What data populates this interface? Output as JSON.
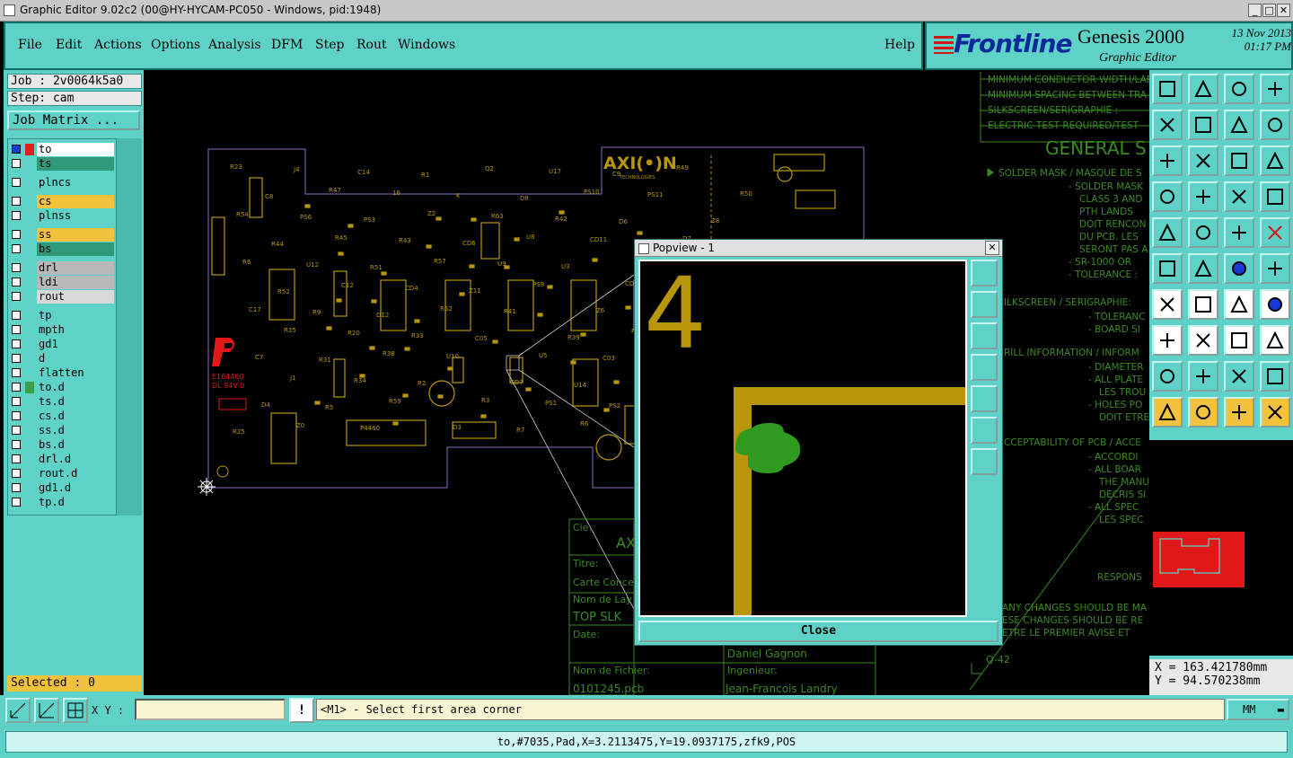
{
  "window": {
    "title": "Graphic Editor 9.02c2 (00@HY-HYCAM-PC050 - Windows, pid:1948)",
    "minimize": "_",
    "maximize": "□",
    "close": "✕"
  },
  "menu": {
    "file": "File",
    "edit": "Edit",
    "actions": "Actions",
    "options": "Options",
    "analysis": "Analysis",
    "dfm": "DFM",
    "step": "Step",
    "rout": "Rout",
    "windows": "Windows",
    "help": "Help"
  },
  "brand": {
    "logo": "Frontline",
    "product": "Genesis 2000",
    "subtitle": "Graphic Editor",
    "date": "13 Nov 2013",
    "time": "01:17 PM"
  },
  "left": {
    "job": "Job : 2v0064k5a0",
    "step": "Step: cam",
    "job_matrix": "Job Matrix ...",
    "selected": "Selected : 0",
    "layers": [
      {
        "name": "to",
        "checked": true,
        "swatch": "#e02020",
        "bg": "#ffffff"
      },
      {
        "name": "ts",
        "checked": false,
        "swatch": "",
        "bg": "#2e9a78"
      },
      {
        "name": "plncs",
        "checked": false,
        "swatch": "",
        "bg": "#5fd2c8"
      },
      {
        "name": "cs",
        "checked": false,
        "swatch": "",
        "bg": "#f2c23c"
      },
      {
        "name": "plnss",
        "checked": false,
        "swatch": "",
        "bg": "#5fd2c8"
      },
      {
        "name": "ss",
        "checked": false,
        "swatch": "",
        "bg": "#f2c23c"
      },
      {
        "name": "bs",
        "checked": false,
        "swatch": "",
        "bg": "#2e9a78"
      },
      {
        "name": "drl",
        "checked": false,
        "swatch": "",
        "bg": "#b8b8b8"
      },
      {
        "name": "ldi",
        "checked": false,
        "swatch": "",
        "bg": "#b8b8b8"
      },
      {
        "name": "rout",
        "checked": false,
        "swatch": "",
        "bg": "#d8d8d8"
      },
      {
        "name": "tp",
        "checked": false,
        "swatch": "",
        "bg": "#5fd2c8"
      },
      {
        "name": "mpth",
        "checked": false,
        "swatch": "",
        "bg": "#5fd2c8"
      },
      {
        "name": "gd1",
        "checked": false,
        "swatch": "",
        "bg": "#5fd2c8"
      },
      {
        "name": "d",
        "checked": false,
        "swatch": "",
        "bg": "#5fd2c8"
      },
      {
        "name": "flatten",
        "checked": false,
        "swatch": "",
        "bg": "#5fd2c8"
      },
      {
        "name": "to.d",
        "checked": false,
        "swatch": "#3aa04a",
        "bg": "#5fd2c8"
      },
      {
        "name": "ts.d",
        "checked": false,
        "swatch": "",
        "bg": "#5fd2c8"
      },
      {
        "name": "cs.d",
        "checked": false,
        "swatch": "",
        "bg": "#5fd2c8"
      },
      {
        "name": "ss.d",
        "checked": false,
        "swatch": "",
        "bg": "#5fd2c8"
      },
      {
        "name": "bs.d",
        "checked": false,
        "swatch": "",
        "bg": "#5fd2c8"
      },
      {
        "name": "drl.d",
        "checked": false,
        "swatch": "",
        "bg": "#5fd2c8"
      },
      {
        "name": "rout.d",
        "checked": false,
        "swatch": "",
        "bg": "#5fd2c8"
      },
      {
        "name": "gd1.d",
        "checked": false,
        "swatch": "",
        "bg": "#5fd2c8"
      },
      {
        "name": "tp.d",
        "checked": false,
        "swatch": "",
        "bg": "#5fd2c8"
      }
    ]
  },
  "canvas": {
    "board_logo": "AXI(•)N",
    "board_logo_sub": "TECHNOLOGIES",
    "ul_marking_1": "E164460",
    "ul_marking_2": "DL 94V-0",
    "notes": [
      "MINIMUM CONDUCTOR WIDTH/LAR",
      "MINIMUM SPACING BETWEEN TRA",
      "SILKSCREEN/SERIGRAPHIE :",
      "ELECTRIC TEST REQUIRED/TEST"
    ],
    "general_notes_title": "GENERAL S",
    "solder_mask_title": "SOLDER MASK / MASQUE DE S",
    "solder_mask_lines": [
      "- SOLDER MASK",
      "CLASS 3 AND",
      "PTH LANDS",
      "DOIT RENCON",
      "DU PCB. LES",
      "SERONT PAS A",
      "- SR-1000 OR",
      "- TOLERANCE :"
    ],
    "silkscreen_title": "ILKSCREEN / SERIGRAPHIE:",
    "silkscreen_lines": [
      "- TOLERANC",
      "- BOARD SI"
    ],
    "drill_title": "RILL INFORMATION / INFORM",
    "drill_lines": [
      "- DIAMETER",
      "- ALL PLATE",
      "LES TROU",
      "- HOLES PO",
      "DOIT ETRE"
    ],
    "acceptability_title": "CCEPTABILITY OF PCB / ACCE",
    "acceptability_lines": [
      "- ACCORDI",
      "- ALL BOAR",
      "THE MANU",
      "DECRIS SI",
      "- ALL SPEC",
      "LES SPEC"
    ],
    "respons": "RESPONS",
    "changes_lines": [
      "ANY CHANGES SHOULD BE MA",
      "ESE CHANGES SHOULD BE RE",
      "ETRE LE PREMIER AVISE ET"
    ],
    "titleblock": {
      "cie_label": "Cie:",
      "cie_value": "AX",
      "titre_label": "Titre:",
      "carte_label": "Carte Conce",
      "nom_layer_label": "Nom de Lay",
      "nom_layer_value": "TOP SLK",
      "date_label": "Date:",
      "author": "Daniel Gagnon",
      "fichier_label": "Nom de Fichier:",
      "fichier_value": "0101245.pcb",
      "ingenieur_label": "Ingenieur:",
      "ingenieur_value": "Jean-Francois Landry",
      "rev": "Q-42"
    },
    "refdes": [
      "R23",
      "J4",
      "C14",
      "R1",
      "Q2",
      "U17",
      "C9",
      "R49",
      "R50",
      "C8",
      "R47",
      "16",
      "K",
      "D8",
      "PS10",
      "PS11",
      "Z8",
      "R54",
      "PS6",
      "PS3",
      "Z2",
      "R63",
      "R42",
      "D6",
      "D7",
      "Q1",
      "R44",
      "R45",
      "R43",
      "CD6",
      "U8",
      "CD11",
      "U7",
      "C05",
      "R6",
      "U12",
      "R51",
      "R57",
      "U9",
      "U3",
      "CD1",
      "U6",
      "U18",
      "R52",
      "C12",
      "CD4",
      "Z11",
      "PS9",
      "Z6",
      "U16",
      "CD8",
      "C17",
      "R9",
      "D12",
      "R62",
      "R41",
      "R39",
      "R60",
      "C16",
      "R10",
      "R35",
      "R20",
      "R33",
      "C05",
      "U5",
      "C03",
      "R40",
      "C9",
      "C7",
      "R31",
      "R38",
      "U10",
      "CD7",
      "U14",
      "U15",
      "R30",
      "R37",
      "J1",
      "R34",
      "R2",
      "R3",
      "PS1",
      "PS2",
      "Z3",
      "R32",
      "D4",
      "R5",
      "R59",
      "D3",
      "R7",
      "R6",
      "R8",
      "C6",
      "R25",
      "Z0",
      "P4460"
    ]
  },
  "popview": {
    "title": "Popview - 1",
    "close_label": "Close",
    "glyph": "4"
  },
  "right": {
    "coords_x": "X = 163.421780mm",
    "coords_y": "Y =  94.570238mm"
  },
  "bottom": {
    "xy_label": "X Y :",
    "xy_value": "",
    "message": "<M1> - Select first area corner",
    "units": "MM",
    "status": "to,#7035,Pad,X=3.2113475,Y=19.0937175,zfk9,POS"
  },
  "colors": {
    "panel": "#5fd2c8",
    "silkscreen": "#b8960c",
    "pad_green": "#2f9a20",
    "drawing_green": "#3a8a22",
    "highlight_red": "#e01818",
    "outline_purple": "#8a6cc8"
  }
}
